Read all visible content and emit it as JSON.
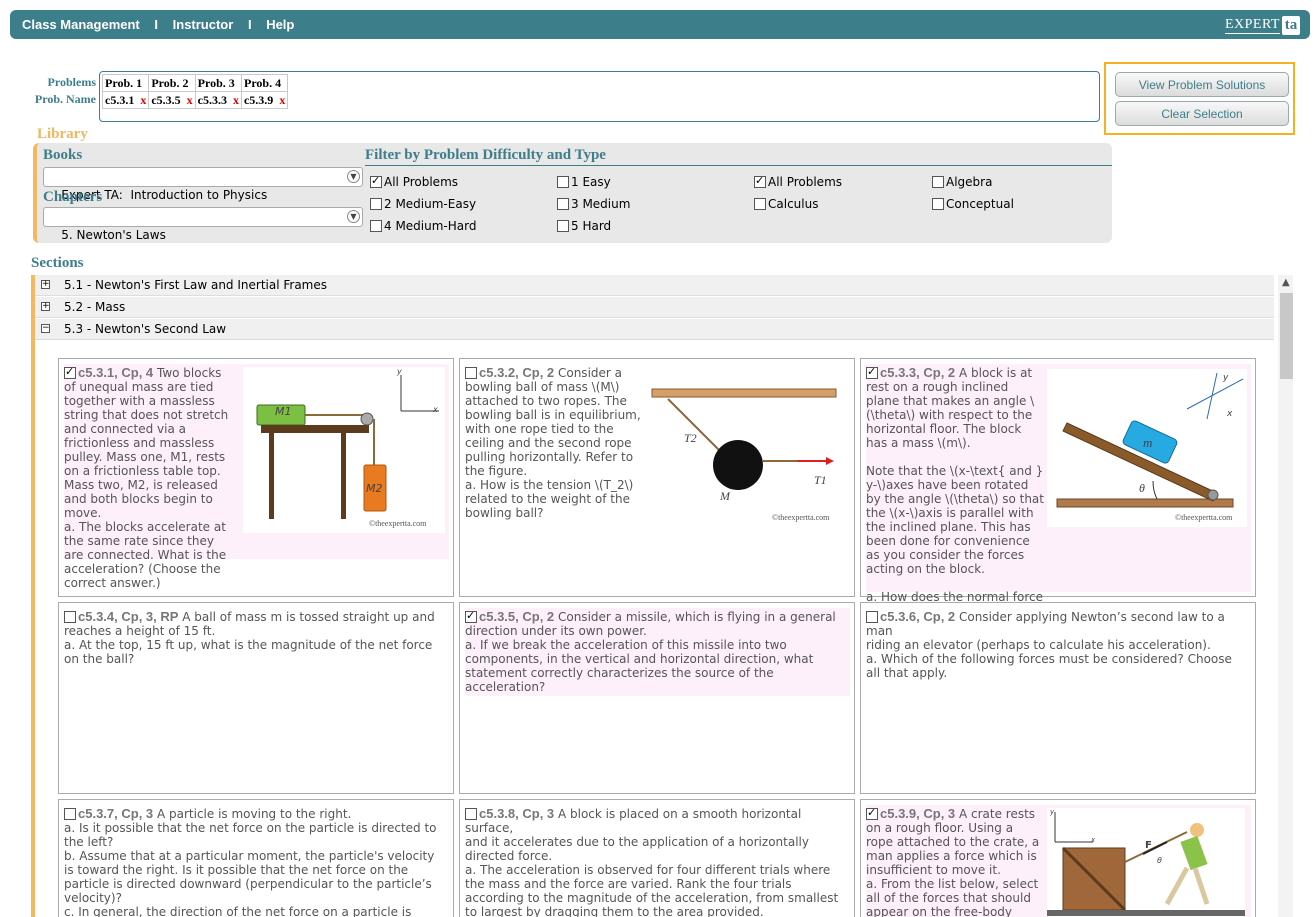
{
  "nav": {
    "items": [
      "Class Management",
      "Instructor",
      "Help"
    ],
    "sep": "I",
    "logo_text": "EXPERT",
    "logo_mark": "ta"
  },
  "problems": {
    "label_problems": "Problems",
    "label_name": "Prob. Name",
    "headers": [
      "Prob. 1",
      "Prob. 2",
      "Prob. 3",
      "Prob. 4"
    ],
    "names": [
      "c5.3.1",
      "c5.3.5",
      "c5.3.3",
      "c5.3.9"
    ],
    "remove": "x"
  },
  "actions": {
    "view": "View Problem Solutions",
    "clear": "Clear Selection"
  },
  "library": {
    "title": "Library",
    "books_label": "Books",
    "book_selected": "Expert TA:  Introduction to Physics",
    "chapters_label": "Chapters",
    "chapter_selected": "5. Newton's Laws",
    "filter_title": "Filter by Problem Difficulty and Type",
    "filters": [
      {
        "label": "All Problems",
        "checked": true
      },
      {
        "label": "2 Medium-Easy",
        "checked": false
      },
      {
        "label": "4 Medium-Hard",
        "checked": false
      },
      {
        "label": "1 Easy",
        "checked": false
      },
      {
        "label": "3 Medium",
        "checked": false
      },
      {
        "label": "5 Hard",
        "checked": false
      },
      {
        "label": "All Problems",
        "checked": true
      },
      {
        "label": "Calculus",
        "checked": false
      },
      {
        "label": "Algebra",
        "checked": false
      },
      {
        "label": "Conceptual",
        "checked": false
      }
    ]
  },
  "sections": {
    "title": "Sections",
    "rows": [
      {
        "sign": "+",
        "label": "5.1 - Newton's First Law and Inertial Frames"
      },
      {
        "sign": "+",
        "label": "5.2 - Mass"
      },
      {
        "sign": "−",
        "label": "5.3 - Newton's Second Law"
      }
    ]
  },
  "cards": [
    {
      "id": "c5.3.1, Cp, 4",
      "checked": true,
      "lead": "Two blocks",
      "body": "of unequal mass are tied together with a massless string that does not stretch and connected via a frictionless and massless pulley. Mass one, M1, rests on a frictionless table top. Mass two, M2, is released and both blocks begin to move.\na. The blocks accelerate at the same rate since they are connected. What is the acceleration? (Choose the correct answer.)",
      "fig_labels": [
        "M1",
        "M2",
        "y",
        "x"
      ]
    },
    {
      "id": "c5.3.2, Cp, 2",
      "checked": false,
      "lead": "Consider a",
      "body": "bowling ball of mass \\(M\\) attached to two ropes. The bowling ball is in equilibrium, with one rope tied to the ceiling and the second rope pulling horizontally. Refer to the figure.\na. How is the tension \\(T_2\\) related to the weight of the bowling ball?",
      "fig_labels": [
        "T2",
        "T1",
        "M"
      ]
    },
    {
      "id": "c5.3.3, Cp, 2",
      "checked": true,
      "lead": "A block is at",
      "body": "rest on a rough inclined plane that makes an angle \\(\\theta\\) with respect to the horizontal floor. The block has a mass \\(m\\).\n\nNote that the \\(x-\\text{ and } y-\\)axes have been rotated by the angle \\(\\theta\\) so that the \\(x-\\)axis is parallel with the inclined plane. This has been done for convenience as you consider the forces acting on the block.\n\na. How does the normal force due to the ramp acting on the block compare to other forces in this situation?",
      "fig_labels": [
        "m",
        "θ",
        "y",
        "x"
      ]
    },
    {
      "id": "c5.3.4, Cp, 3, RP",
      "checked": false,
      "lead": "A ball of mass m is tossed straight up and",
      "body": "reaches a height of 15 ft.\na. At the top, 15 ft up, what is the magnitude of the net force on the ball?"
    },
    {
      "id": "c5.3.5, Cp, 2",
      "checked": true,
      "lead": "Consider a missile, which is flying in a general",
      "body": "direction under its own power.\na. If we break the acceleration of this missile into two components, in the vertical and horizontal direction, what statement correctly characterizes the source of the acceleration?"
    },
    {
      "id": "c5.3.6, Cp, 2",
      "checked": false,
      "lead": "Consider applying Newton’s second law to a man",
      "body": "riding an elevator (perhaps to calculate his acceleration).\na. Which of the following forces must be considered? Choose all that apply."
    },
    {
      "id": "c5.3.7, Cp, 3",
      "checked": false,
      "lead": "A particle is moving to the right.",
      "body": "a. Is it possible that the net force on the particle is directed to the left?\nb. Assume that at a particular moment, the particle's velocity is toward the right. Is it possible that the net force on the particle is directed downward (perpendicular to the particle’s velocity)?\nc. In general, the direction of the net force on a particle is always the same as the direction of its velocity."
    },
    {
      "id": "c5.3.8, Cp, 3",
      "checked": false,
      "lead": "A block is placed on a smooth horizontal surface,",
      "body": "and it accelerates due to the application of a horizontally directed force.\na. The acceleration is observed for four different trials where the mass and the force are varied. Rank the four trials according to the magnitude of the acceleration, from smallest to largest by dragging them to the area provided."
    },
    {
      "id": "c5.3.9, Cp, 3",
      "checked": true,
      "lead": "A crate rests",
      "body": "on a rough floor. Using a rope attached to the crate, a man applies a force which is insufficient to move it.\na. From the list below, select all of the forces that should appear on the free-body",
      "fig_labels": [
        "F",
        "θ",
        "y",
        "x"
      ]
    }
  ],
  "copyright": "©theexpertta.com"
}
